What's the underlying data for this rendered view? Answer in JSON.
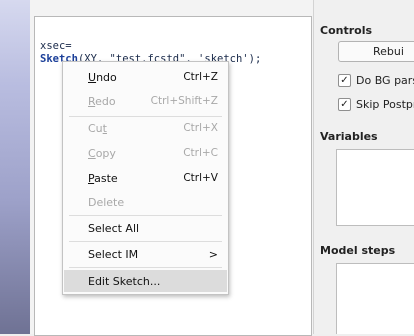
{
  "editor": {
    "code_line_1": "xsec=",
    "code_line_2_keyword": "Sketch",
    "code_line_2_rest": "(XY, \"test.fcstd\", 'sketch');"
  },
  "context_menu": {
    "items": [
      {
        "label": "Undo",
        "mnemonic": "U",
        "rest": "ndo",
        "shortcut": "Ctrl+Z",
        "enabled": true
      },
      {
        "label": "Redo",
        "mnemonic": "R",
        "rest": "edo",
        "shortcut": "Ctrl+Shift+Z",
        "enabled": false
      },
      {
        "label": "Cut",
        "pre": "Cu",
        "mnemonic": "t",
        "shortcut": "Ctrl+X",
        "enabled": false
      },
      {
        "label": "Copy",
        "mnemonic": "C",
        "rest": "opy",
        "shortcut": "Ctrl+C",
        "enabled": false
      },
      {
        "label": "Paste",
        "mnemonic": "P",
        "rest": "aste",
        "shortcut": "Ctrl+V",
        "enabled": true
      },
      {
        "label": "Delete",
        "shortcut": "",
        "enabled": false
      },
      {
        "label": "Select All",
        "shortcut": "",
        "enabled": true
      },
      {
        "label": "Select IM",
        "submenu_arrow": ">",
        "enabled": true
      },
      {
        "label": "Edit Sketch...",
        "enabled": true,
        "highlighted": true
      }
    ]
  },
  "right_panel": {
    "controls_title": "Controls",
    "rebuild_label": "Rebui",
    "checkbox_1_label": "Do BG pars",
    "checkbox_1_mark": "✓",
    "checkbox_2_label": "Skip Postpr",
    "checkbox_2_mark": "✓",
    "variables_title": "Variables",
    "model_steps_title": "Model steps"
  }
}
